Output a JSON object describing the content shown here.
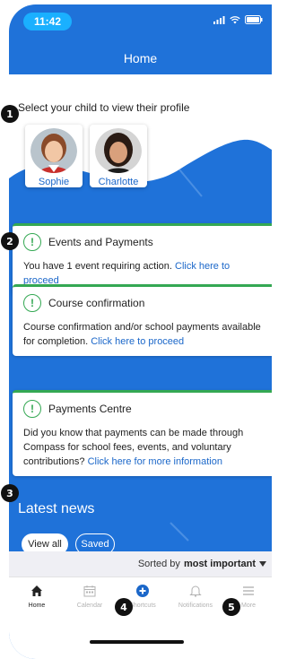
{
  "status_bar": {
    "time": "11:42"
  },
  "header": {
    "title": "Home"
  },
  "children": {
    "prompt": "Select your child to view their profile",
    "items": [
      {
        "name": "Sophie"
      },
      {
        "name": "Charlotte"
      }
    ]
  },
  "cards": [
    {
      "title": "Events and Payments",
      "body": "You have 1 event requiring action.",
      "link": "Click here to proceed"
    },
    {
      "title": "Course confirmation",
      "body": "Course confirmation and/or school payments available for completion.",
      "link": "Click here to proceed"
    },
    {
      "title": "Payments Centre",
      "body": "Did you know that payments can be made through Compass for school fees, events, and voluntary contributions?",
      "link": "Click here for more information"
    }
  ],
  "news": {
    "title": "Latest news",
    "filters": [
      "View all",
      "Saved"
    ]
  },
  "sort": {
    "prefix": "Sorted by",
    "value": "most important"
  },
  "tabs": [
    {
      "label": "Home",
      "icon": "home-icon"
    },
    {
      "label": "Calendar",
      "icon": "calendar-icon"
    },
    {
      "label": "Shortcuts",
      "icon": "plus-circle-icon"
    },
    {
      "label": "Notifications",
      "icon": "bell-icon"
    },
    {
      "label": "More",
      "icon": "menu-icon"
    }
  ],
  "callouts": [
    "1",
    "2",
    "3",
    "4",
    "5"
  ],
  "colors": {
    "brand_blue": "#1f72d9",
    "status_green": "#34a853",
    "link_blue": "#1b67c9",
    "callout_black": "#111111"
  }
}
